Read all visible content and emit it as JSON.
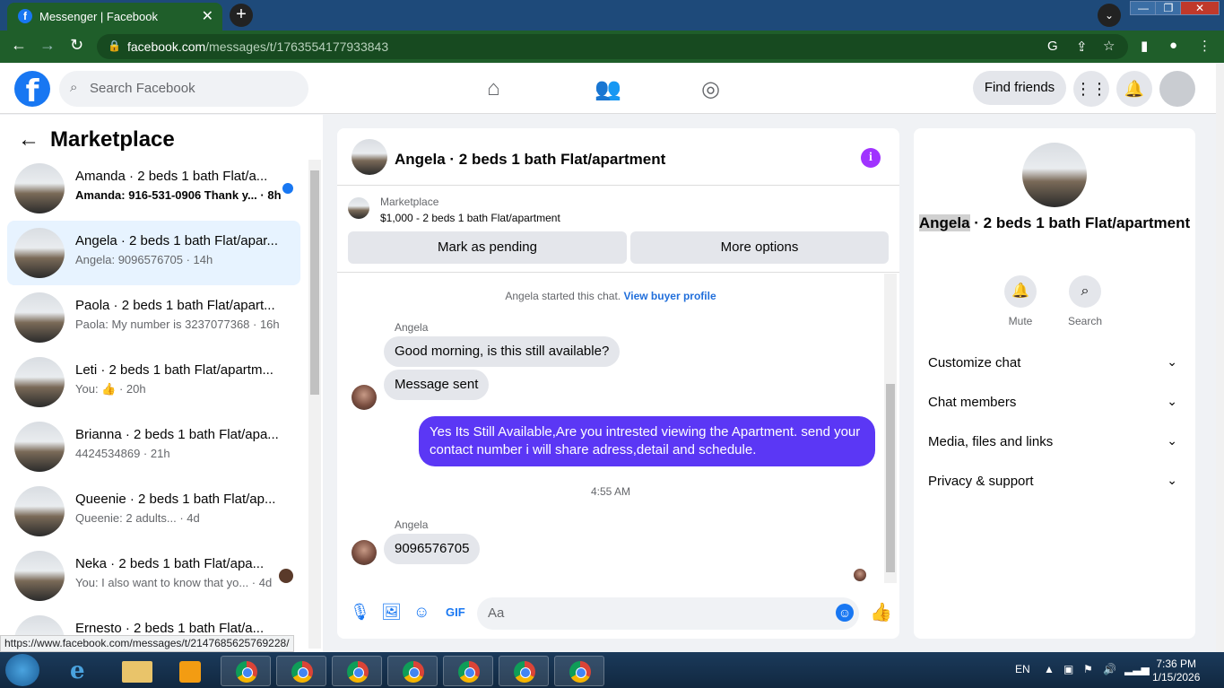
{
  "browser": {
    "tab_title": "Messenger | Facebook",
    "tab_close": "✕",
    "url_host": "facebook.com",
    "url_path": "/messages/t/1763554177933843",
    "status_url": "https://www.facebook.com/messages/t/2147685625769228/"
  },
  "fb": {
    "search_placeholder": "Search Facebook",
    "find_friends": "Find friends"
  },
  "marketplace": {
    "title": "Marketplace",
    "conversations": [
      {
        "name": "Amanda · 2 beds 1 bath Flat/a...",
        "snippet": "Amanda: 916-531-0906 Thank y... · 8h",
        "unread": true
      },
      {
        "name": "Angela · 2 beds 1 bath Flat/apar...",
        "snippet": "Angela: 9096576705 · 14h",
        "active": true
      },
      {
        "name": "Paola · 2 beds 1 bath Flat/apart...",
        "snippet": "Paola: My number is 3237077368 · 16h"
      },
      {
        "name": "Leti · 2 beds 1 bath Flat/apartm...",
        "snippet": "You: 👍 · 20h"
      },
      {
        "name": "Brianna · 2 beds 1 bath Flat/apa...",
        "snippet": "4424534869 · 21h"
      },
      {
        "name": "Queenie · 2 beds 1 bath Flat/ap...",
        "snippet": "Queenie: 2 adults... · 4d"
      },
      {
        "name": "Neka · 2 beds 1 bath Flat/apa...",
        "snippet": "You: I also want to know that yo... · 4d"
      },
      {
        "name": "Ernesto · 2 beds 1 bath Flat/a...",
        "snippet": ""
      }
    ]
  },
  "chat": {
    "header_name": "Angela · 2 beds 1 bath Flat/apartment",
    "listing_label": "Marketplace",
    "listing_price": "$1,000 - 2 beds 1 bath Flat/apartment",
    "mark_pending": "Mark as pending",
    "more_options": "More options",
    "started_text": "Angela started this chat.",
    "view_buyer_profile": "View buyer profile",
    "sender_1": "Angela",
    "msg_1": "Good morning, is this still available?",
    "msg_2": "Message sent",
    "msg_out": "Yes Its Still Available,Are you intrested viewing the Apartment. send your contact number i will share adress,detail and schedule.",
    "timestamp": "4:55 AM",
    "sender_2": "Angela",
    "msg_3": "9096576705",
    "composer_placeholder": "Aa"
  },
  "details": {
    "title_name": "Angela",
    "title_rest": " · 2 beds 1 bath Flat/apartment",
    "mute_label": "Mute",
    "search_label": "Search",
    "rows": [
      "Customize chat",
      "Chat members",
      "Media, files and links",
      "Privacy & support"
    ]
  },
  "taskbar": {
    "lang": "EN",
    "time": "7:36 PM",
    "date": "1/15/2026"
  }
}
